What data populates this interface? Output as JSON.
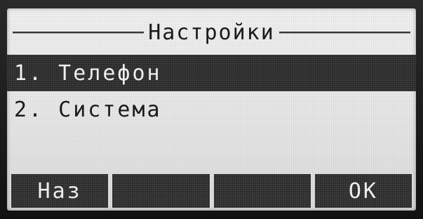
{
  "screen": {
    "title": "Настройки"
  },
  "menu": {
    "items": [
      {
        "label": "1. Телефон",
        "selected": true
      },
      {
        "label": "2. Система",
        "selected": false
      }
    ]
  },
  "softkeys": [
    {
      "label": "Наз"
    },
    {
      "label": ""
    },
    {
      "label": ""
    },
    {
      "label": "ОК"
    }
  ]
}
